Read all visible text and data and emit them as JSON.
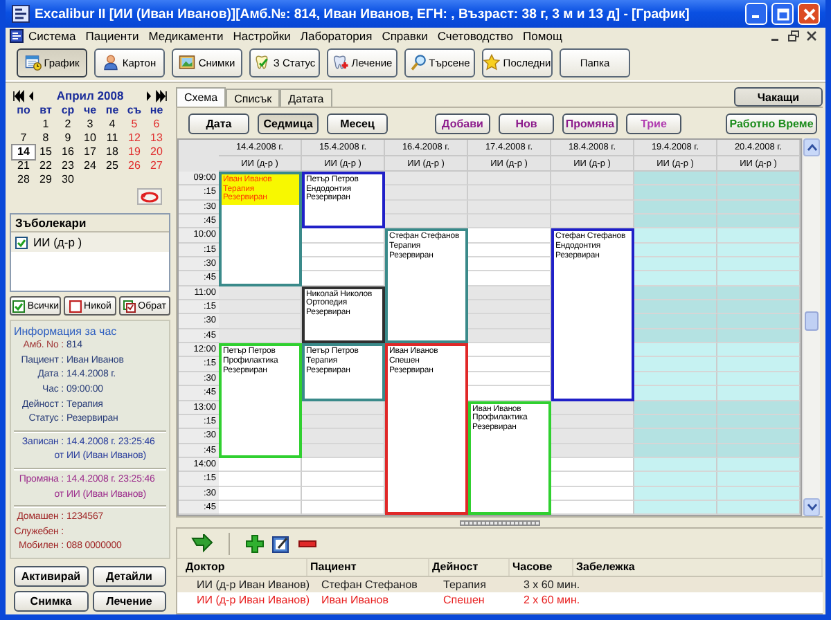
{
  "window": {
    "title": "Excalibur II [ИИ (Иван Иванов)][Амб.№: 814, Иван Иванов, ЕГН: , Възраст: 38 г, 3 м и 13 д] - [График]"
  },
  "menu": [
    "Система",
    "Пациенти",
    "Медикаменти",
    "Настройки",
    "Лаборатория",
    "Справки",
    "Счетоводство",
    "Помощ"
  ],
  "toolbar": [
    {
      "label": "График",
      "selected": true
    },
    {
      "label": "Картон",
      "selected": false
    },
    {
      "label": "Снимки",
      "selected": false
    },
    {
      "label": "З Статус",
      "selected": false
    },
    {
      "label": "Лечение",
      "selected": false
    },
    {
      "label": "Търсене",
      "selected": false
    },
    {
      "label": "Последни",
      "selected": false
    },
    {
      "label": "Папка",
      "selected": false
    }
  ],
  "mini_calendar": {
    "title": "Април 2008",
    "weekdays": [
      "по",
      "вт",
      "ср",
      "че",
      "пе",
      "съ",
      "не"
    ],
    "weeks": [
      [
        {
          "kind": "blank"
        },
        {
          "kind": "day",
          "day": "1",
          "weekend": false,
          "selected": false
        },
        {
          "kind": "day",
          "day": "2",
          "weekend": false,
          "selected": false
        },
        {
          "kind": "day",
          "day": "3",
          "weekend": false,
          "selected": false
        },
        {
          "kind": "day",
          "day": "4",
          "weekend": false,
          "selected": false
        },
        {
          "kind": "day",
          "day": "5",
          "weekend": true,
          "selected": false
        },
        {
          "kind": "day",
          "day": "6",
          "weekend": true,
          "selected": false
        }
      ],
      [
        {
          "kind": "day",
          "day": "7",
          "weekend": false,
          "selected": false
        },
        {
          "kind": "day",
          "day": "8",
          "weekend": false,
          "selected": false
        },
        {
          "kind": "day",
          "day": "9",
          "weekend": false,
          "selected": false
        },
        {
          "kind": "day",
          "day": "10",
          "weekend": false,
          "selected": false
        },
        {
          "kind": "day",
          "day": "11",
          "weekend": false,
          "selected": false
        },
        {
          "kind": "day",
          "day": "12",
          "weekend": true,
          "selected": false
        },
        {
          "kind": "day",
          "day": "13",
          "weekend": true,
          "selected": false
        }
      ],
      [
        {
          "kind": "day",
          "day": "14",
          "weekend": false,
          "selected": true
        },
        {
          "kind": "day",
          "day": "15",
          "weekend": false,
          "selected": false
        },
        {
          "kind": "day",
          "day": "16",
          "weekend": false,
          "selected": false
        },
        {
          "kind": "day",
          "day": "17",
          "weekend": false,
          "selected": false
        },
        {
          "kind": "day",
          "day": "18",
          "weekend": false,
          "selected": false
        },
        {
          "kind": "day",
          "day": "19",
          "weekend": true,
          "selected": false
        },
        {
          "kind": "day",
          "day": "20",
          "weekend": true,
          "selected": false
        }
      ],
      [
        {
          "kind": "day",
          "day": "21",
          "weekend": false,
          "selected": false
        },
        {
          "kind": "day",
          "day": "22",
          "weekend": false,
          "selected": false
        },
        {
          "kind": "day",
          "day": "23",
          "weekend": false,
          "selected": false
        },
        {
          "kind": "day",
          "day": "24",
          "weekend": false,
          "selected": false
        },
        {
          "kind": "day",
          "day": "25",
          "weekend": false,
          "selected": false
        },
        {
          "kind": "day",
          "day": "26",
          "weekend": true,
          "selected": false
        },
        {
          "kind": "day",
          "day": "27",
          "weekend": true,
          "selected": false
        }
      ],
      [
        {
          "kind": "day",
          "day": "28",
          "weekend": false,
          "selected": false
        },
        {
          "kind": "day",
          "day": "29",
          "weekend": false,
          "selected": false
        },
        {
          "kind": "day",
          "day": "30",
          "weekend": false,
          "selected": false
        }
      ]
    ]
  },
  "dentists": {
    "title": "Зъболекари",
    "items": [
      {
        "label": "ИИ (д-р )",
        "checked": true
      }
    ]
  },
  "dentist_buttons": [
    "Всички",
    "Никой",
    "Обрат"
  ],
  "info": {
    "title": "Информация за час",
    "groups": [
      {
        "color": "#283c78",
        "rows": [
          {
            "label": "Амб. No :",
            "value": "814",
            "color": "#a03838"
          },
          {
            "label": "Пациент :",
            "value": "Иван Иванов",
            "color": "#283c78"
          },
          {
            "label": "Дата :",
            "value": "14.4.2008 г.",
            "color": "#283c78"
          },
          {
            "label": "Час :",
            "value": "09:00:00",
            "color": "#283c78"
          },
          {
            "label": "Дейност :",
            "value": "Терапия",
            "color": "#283c78"
          },
          {
            "label": "Статус :",
            "value": "Резервиран",
            "color": "#283c78"
          }
        ]
      },
      {
        "color": "#283c9c",
        "rows": [
          {
            "label": "Записан :",
            "value": "14.4.2008 г. 23:25:46",
            "color": "#283c9c"
          },
          {
            "label": "от",
            "value": "ИИ (Иван Иванов)",
            "color": "#283c9c"
          }
        ]
      },
      {
        "color": "#9c2c8c",
        "rows": [
          {
            "label": "Промяна :",
            "value": "14.4.2008 г. 23:25:46",
            "color": "#9c2c8c"
          },
          {
            "label": "от",
            "value": "ИИ (Иван Иванов)",
            "color": "#9c2c8c"
          }
        ]
      },
      {
        "color": "#a02828",
        "rows": [
          {
            "label": "Домашен :",
            "value": "1234567",
            "color": "#a02828"
          },
          {
            "label": "Служебен :",
            "color": "#a02828"
          },
          {
            "label": "Мобилен :",
            "value": "088 0000000",
            "color": "#a02828"
          }
        ]
      }
    ]
  },
  "info_buttons": [
    "Активирай",
    "Детайли",
    "Снимка",
    "Лечение"
  ],
  "tabs": [
    {
      "label": "Схема",
      "selected": true
    },
    {
      "label": "Списък",
      "selected": false
    },
    {
      "label": "Датата",
      "selected": false
    }
  ],
  "waiting_button": "Чакащи",
  "view_buttons": [
    {
      "label": "Дата",
      "selected": false
    },
    {
      "label": "Седмица",
      "selected": true
    },
    {
      "label": "Месец",
      "selected": false
    }
  ],
  "action_buttons": [
    {
      "label": "Добави",
      "color": "#8c1c8c"
    },
    {
      "label": "Нов",
      "color": "#8c1c8c"
    },
    {
      "label": "Промяна",
      "color": "#8c1c8c"
    },
    {
      "label": "Трие",
      "color": "#b03cb0"
    }
  ],
  "work_time_button": {
    "label": "Работно Време",
    "color": "#1c8c1c"
  },
  "schedule": {
    "hours": [
      {
        "label": "09:00",
        "shaded": true,
        "quarters": [
          ":15",
          ":30",
          ":45"
        ]
      },
      {
        "label": "10:00",
        "shaded": false,
        "quarters": [
          ":15",
          ":30",
          ":45"
        ]
      },
      {
        "label": "11:00",
        "shaded": true,
        "quarters": [
          ":15",
          ":30",
          ":45"
        ]
      },
      {
        "label": "12:00",
        "shaded": false,
        "quarters": [
          ":15",
          ":30",
          ":45"
        ]
      },
      {
        "label": "13:00",
        "shaded": true,
        "quarters": [
          ":15",
          ":30",
          ":45"
        ]
      },
      {
        "label": "14:00",
        "shaded": false,
        "quarters": [
          ":15",
          ":30",
          ":45"
        ]
      }
    ],
    "days": [
      {
        "date": "14.4.2008 г.",
        "doctor": "ИИ (д-р )",
        "weekend": false,
        "slots": [
          {
            "kind": "appointment",
            "patient": "Иван Иванов",
            "activity": "Терапия",
            "status": "Резервиран",
            "color": "#3a8a8a",
            "selected": true
          },
          {
            "kind": "busy"
          },
          {
            "kind": "busy"
          },
          {
            "kind": "busy"
          },
          {
            "kind": "busy"
          },
          {
            "kind": "busy"
          },
          {
            "kind": "busy"
          },
          {
            "kind": "busy"
          },
          {
            "kind": "free"
          },
          {
            "kind": "free"
          },
          {
            "kind": "free"
          },
          {
            "kind": "free"
          },
          {
            "kind": "appointment",
            "patient": "Петър Петров",
            "activity": "Профилактика",
            "status": "Резервиран",
            "color": "#30d030",
            "selected": false
          },
          {
            "kind": "busy"
          },
          {
            "kind": "busy"
          },
          {
            "kind": "busy"
          },
          {
            "kind": "busy"
          },
          {
            "kind": "busy"
          },
          {
            "kind": "busy"
          },
          {
            "kind": "busy"
          },
          {
            "kind": "free"
          },
          {
            "kind": "free"
          },
          {
            "kind": "free"
          },
          {
            "kind": "free"
          }
        ]
      },
      {
        "date": "15.4.2008 г.",
        "doctor": "ИИ (д-р )",
        "weekend": false,
        "slots": [
          {
            "kind": "appointment",
            "patient": "Петър Петров",
            "activity": "Ендодонтия",
            "status": "Резервиран",
            "color": "#2020c8",
            "selected": false
          },
          {
            "kind": "busy"
          },
          {
            "kind": "busy"
          },
          {
            "kind": "busy"
          },
          {
            "kind": "free"
          },
          {
            "kind": "free"
          },
          {
            "kind": "free"
          },
          {
            "kind": "free"
          },
          {
            "kind": "appointment",
            "patient": "Николай Николов",
            "activity": "Ортопедия",
            "status": "Резервиран",
            "color": "#303030",
            "selected": false
          },
          {
            "kind": "busy"
          },
          {
            "kind": "busy"
          },
          {
            "kind": "busy"
          },
          {
            "kind": "appointment",
            "patient": "Петър Петров",
            "activity": "Терапия",
            "status": "Резервиран",
            "color": "#3a8a8a",
            "selected": false
          },
          {
            "kind": "busy"
          },
          {
            "kind": "busy"
          },
          {
            "kind": "busy"
          },
          {
            "kind": "free"
          },
          {
            "kind": "free"
          },
          {
            "kind": "free"
          },
          {
            "kind": "free"
          },
          {
            "kind": "free"
          },
          {
            "kind": "free"
          },
          {
            "kind": "free"
          },
          {
            "kind": "free"
          }
        ]
      },
      {
        "date": "16.4.2008 г.",
        "doctor": "ИИ (д-р )",
        "weekend": false,
        "slots": [
          {
            "kind": "free"
          },
          {
            "kind": "free"
          },
          {
            "kind": "free"
          },
          {
            "kind": "free"
          },
          {
            "kind": "appointment",
            "patient": "Стефан Стефанов",
            "activity": "Терапия",
            "status": "Резервиран",
            "color": "#3a8a8a",
            "selected": false
          },
          {
            "kind": "busy"
          },
          {
            "kind": "busy"
          },
          {
            "kind": "busy"
          },
          {
            "kind": "busy"
          },
          {
            "kind": "busy"
          },
          {
            "kind": "busy"
          },
          {
            "kind": "busy"
          },
          {
            "kind": "appointment",
            "patient": "Иван Иванов",
            "activity": "Спешен",
            "status": "Резервиран",
            "color": "#e02828",
            "selected": false
          },
          {
            "kind": "busy"
          },
          {
            "kind": "busy"
          },
          {
            "kind": "busy"
          },
          {
            "kind": "busy"
          },
          {
            "kind": "busy"
          },
          {
            "kind": "busy"
          },
          {
            "kind": "busy"
          },
          {
            "kind": "busy"
          },
          {
            "kind": "busy"
          },
          {
            "kind": "busy"
          },
          {
            "kind": "busy"
          }
        ]
      },
      {
        "date": "17.4.2008 г.",
        "doctor": "ИИ (д-р )",
        "weekend": false,
        "slots": [
          {
            "kind": "free"
          },
          {
            "kind": "free"
          },
          {
            "kind": "free"
          },
          {
            "kind": "free"
          },
          {
            "kind": "free"
          },
          {
            "kind": "free"
          },
          {
            "kind": "free"
          },
          {
            "kind": "free"
          },
          {
            "kind": "free"
          },
          {
            "kind": "free"
          },
          {
            "kind": "free"
          },
          {
            "kind": "free"
          },
          {
            "kind": "free"
          },
          {
            "kind": "free"
          },
          {
            "kind": "free"
          },
          {
            "kind": "free"
          },
          {
            "kind": "appointment",
            "patient": "Иван Иванов",
            "activity": "Профилактика",
            "status": "Резервиран",
            "color": "#30d030",
            "selected": false
          },
          {
            "kind": "busy"
          },
          {
            "kind": "busy"
          },
          {
            "kind": "busy"
          },
          {
            "kind": "busy"
          },
          {
            "kind": "busy"
          },
          {
            "kind": "busy"
          },
          {
            "kind": "busy"
          }
        ]
      },
      {
        "date": "18.4.2008 г.",
        "doctor": "ИИ (д-р )",
        "weekend": false,
        "slots": [
          {
            "kind": "free"
          },
          {
            "kind": "free"
          },
          {
            "kind": "free"
          },
          {
            "kind": "free"
          },
          {
            "kind": "appointment",
            "patient": "Стефан Стефанов",
            "activity": "Ендодонтия",
            "status": "Резервиран",
            "color": "#2020c8",
            "selected": false
          },
          {
            "kind": "busy"
          },
          {
            "kind": "busy"
          },
          {
            "kind": "busy"
          },
          {
            "kind": "busy"
          },
          {
            "kind": "busy"
          },
          {
            "kind": "busy"
          },
          {
            "kind": "busy"
          },
          {
            "kind": "busy"
          },
          {
            "kind": "busy"
          },
          {
            "kind": "busy"
          },
          {
            "kind": "busy"
          },
          {
            "kind": "free"
          },
          {
            "kind": "free"
          },
          {
            "kind": "free"
          },
          {
            "kind": "free"
          },
          {
            "kind": "free"
          },
          {
            "kind": "free"
          },
          {
            "kind": "free"
          },
          {
            "kind": "free"
          }
        ]
      },
      {
        "date": "19.4.2008 г.",
        "doctor": "ИИ (д-р )",
        "weekend": true,
        "slots": [
          {
            "kind": "free"
          },
          {
            "kind": "free"
          },
          {
            "kind": "free"
          },
          {
            "kind": "free"
          },
          {
            "kind": "free"
          },
          {
            "kind": "free"
          },
          {
            "kind": "free"
          },
          {
            "kind": "free"
          },
          {
            "kind": "free"
          },
          {
            "kind": "free"
          },
          {
            "kind": "free"
          },
          {
            "kind": "free"
          },
          {
            "kind": "free"
          },
          {
            "kind": "free"
          },
          {
            "kind": "free"
          },
          {
            "kind": "free"
          },
          {
            "kind": "free"
          },
          {
            "kind": "free"
          },
          {
            "kind": "free"
          },
          {
            "kind": "free"
          },
          {
            "kind": "free"
          },
          {
            "kind": "free"
          },
          {
            "kind": "free"
          },
          {
            "kind": "free"
          }
        ]
      },
      {
        "date": "20.4.2008 г.",
        "doctor": "ИИ (д-р )",
        "weekend": true,
        "slots": [
          {
            "kind": "free"
          },
          {
            "kind": "free"
          },
          {
            "kind": "free"
          },
          {
            "kind": "free"
          },
          {
            "kind": "free"
          },
          {
            "kind": "free"
          },
          {
            "kind": "free"
          },
          {
            "kind": "free"
          },
          {
            "kind": "free"
          },
          {
            "kind": "free"
          },
          {
            "kind": "free"
          },
          {
            "kind": "free"
          },
          {
            "kind": "free"
          },
          {
            "kind": "free"
          },
          {
            "kind": "free"
          },
          {
            "kind": "free"
          },
          {
            "kind": "free"
          },
          {
            "kind": "free"
          },
          {
            "kind": "free"
          },
          {
            "kind": "free"
          },
          {
            "kind": "free"
          },
          {
            "kind": "free"
          },
          {
            "kind": "free"
          },
          {
            "kind": "free"
          }
        ]
      }
    ]
  },
  "table": {
    "columns": [
      "Доктор",
      "Пациент",
      "Дейност",
      "Часове",
      "Забележка"
    ],
    "rows": [
      {
        "cells": [
          "ИИ (д-р Иван Иванов)",
          "Стефан Стефанов",
          "Терапия",
          "3 х 60 мин."
        ],
        "selected": true,
        "color": "#202020"
      },
      {
        "cells": [
          "ИИ (д-р Иван Иванов)",
          "Иван Иванов",
          "Спешен",
          "2 х 60 мин."
        ],
        "selected": false,
        "color": "#e82020"
      }
    ]
  }
}
